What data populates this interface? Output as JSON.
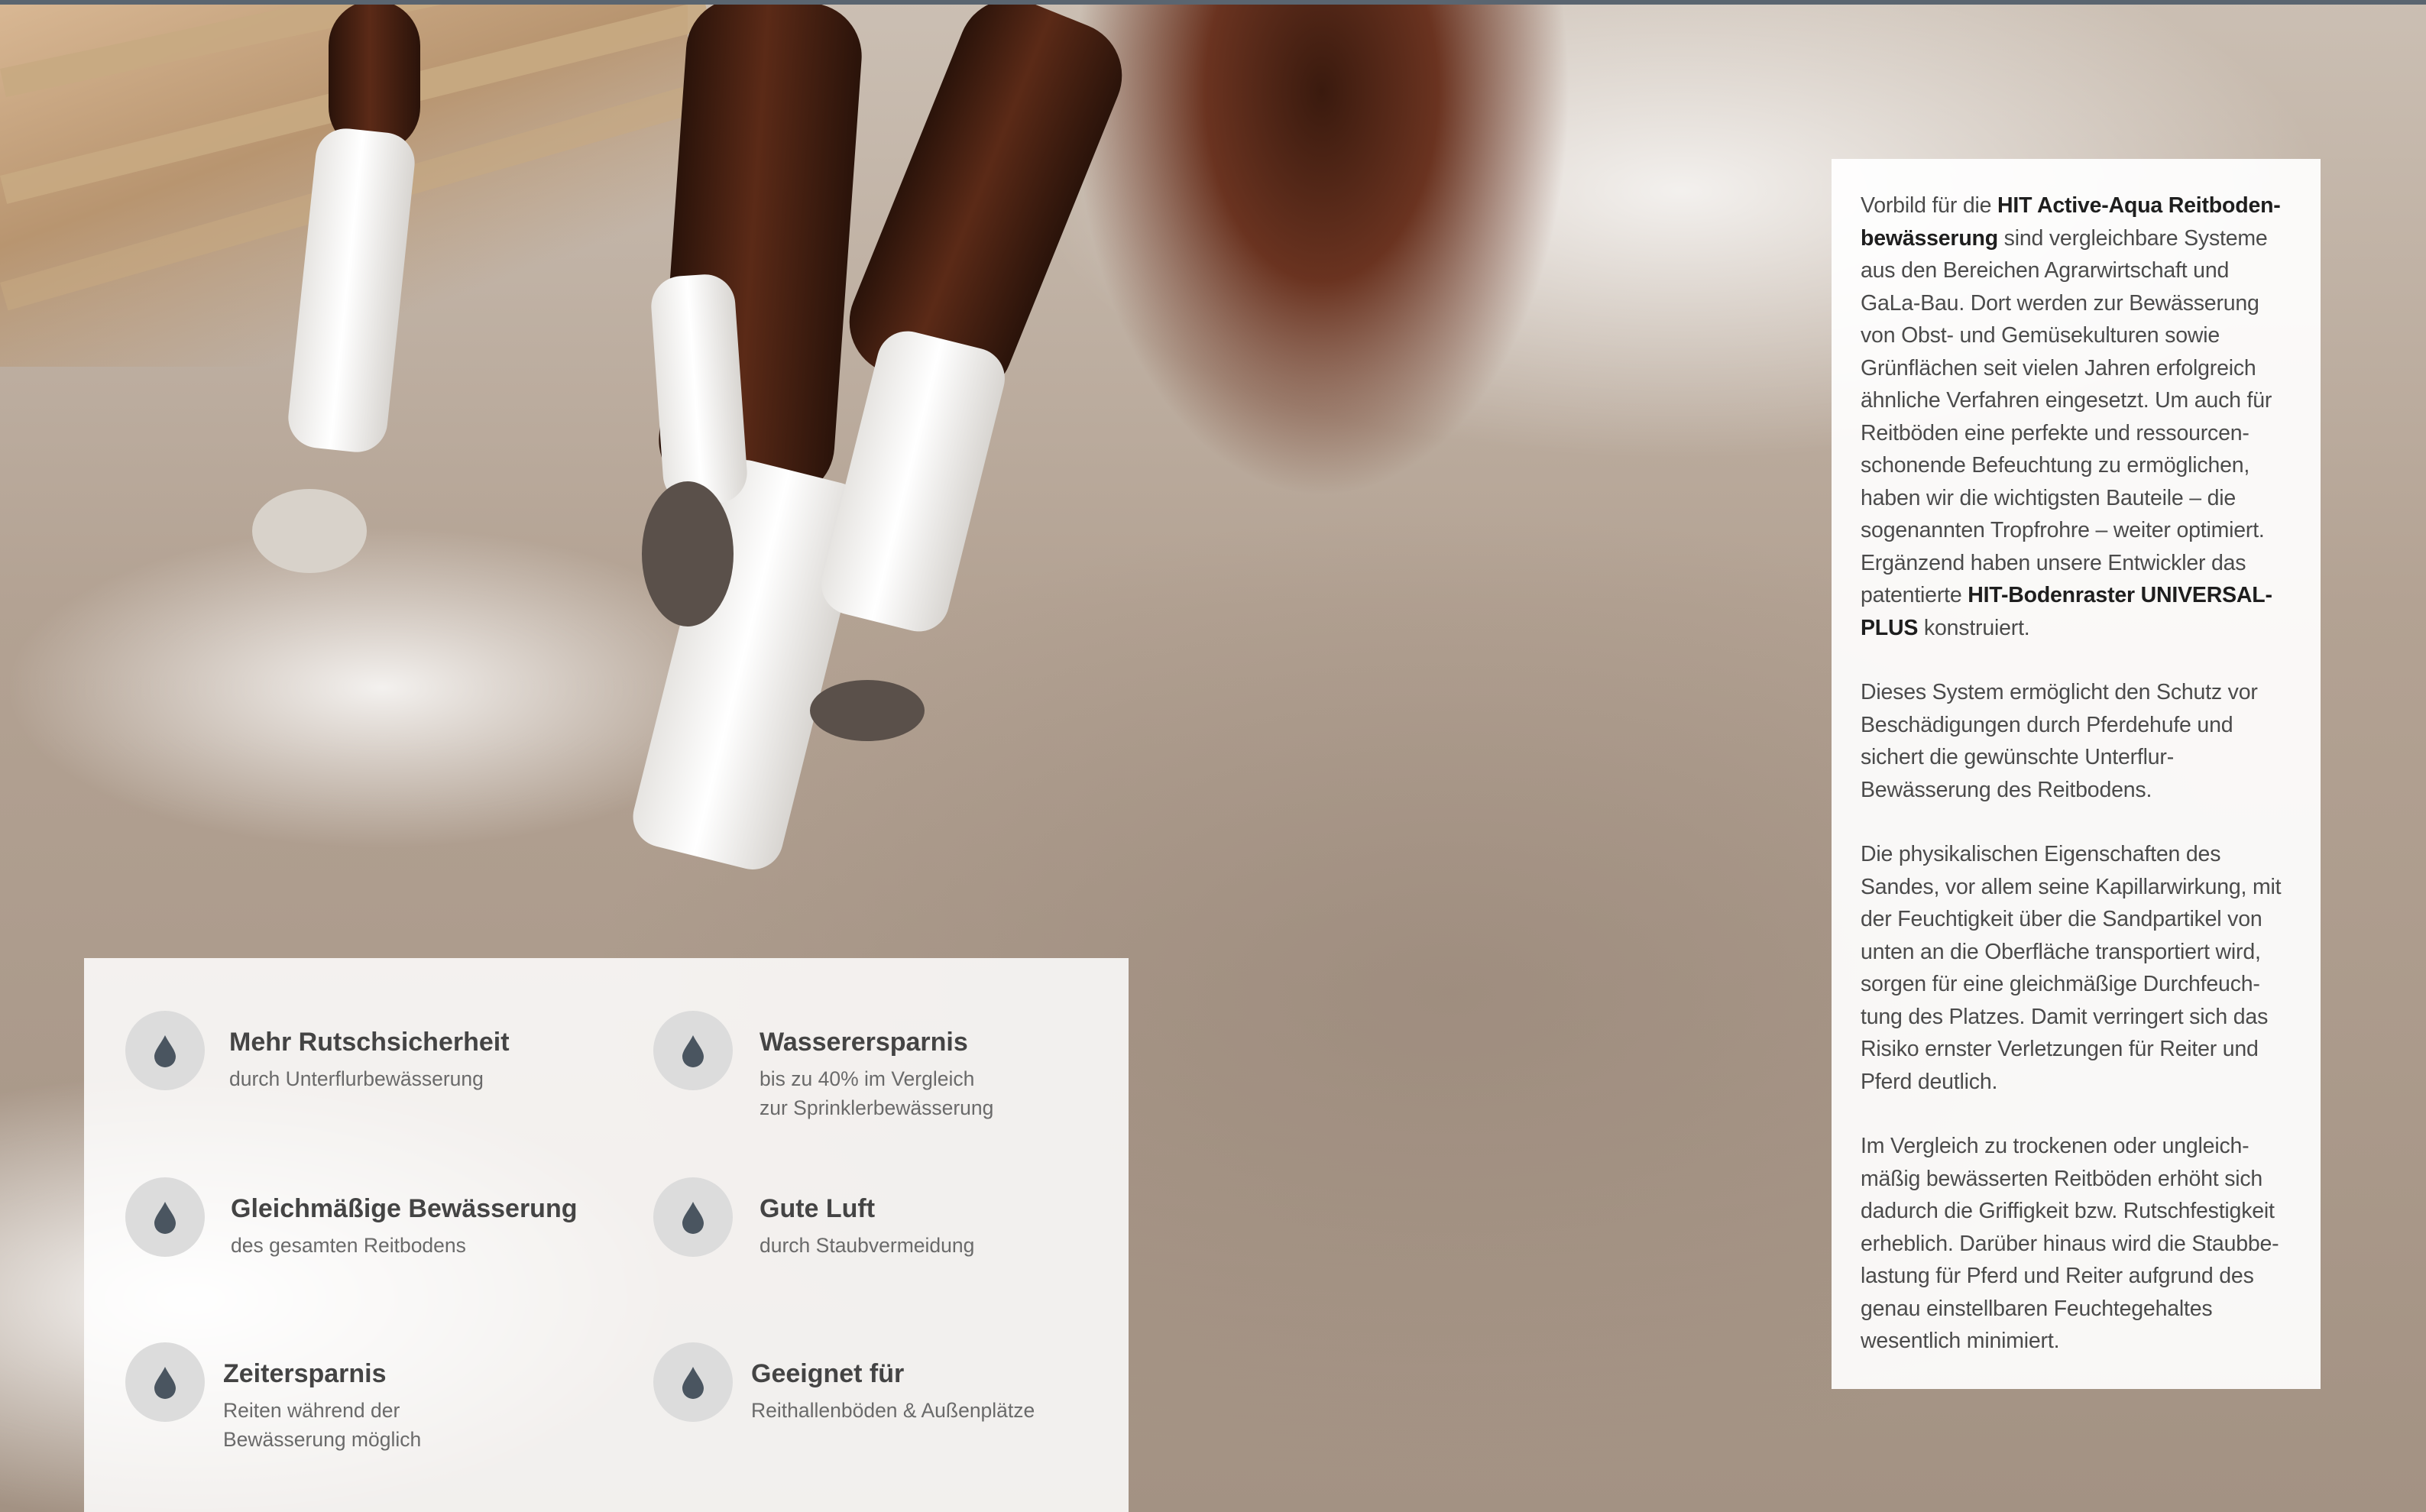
{
  "colors": {
    "panel_bg": "#ffffff",
    "icon_circle": "#dcdcdc",
    "icon_drop": "#4a5560",
    "text": "#4b4b4b",
    "bold_text": "#1e1e1e"
  },
  "background_image": {
    "description_icon": "horse-legs-in-riding-arena-photo"
  },
  "features": [
    {
      "icon": "water-drop-icon",
      "title": "Mehr Rutschsicherheit",
      "subtitle_lines": [
        "durch Unterflurbewässerung"
      ]
    },
    {
      "icon": "water-drop-icon",
      "title": "Wasserersparnis",
      "subtitle_lines": [
        "bis zu 40% im Vergleich",
        "zur Sprinklerbewässerung"
      ]
    },
    {
      "icon": "water-drop-icon",
      "title": "Gleichmäßige Bewässerung",
      "subtitle_lines": [
        "des gesamten Reitbodens"
      ]
    },
    {
      "icon": "water-drop-icon",
      "title": "Gute Luft",
      "subtitle_lines": [
        "durch Staubvermeidung"
      ]
    },
    {
      "icon": "water-drop-icon",
      "title": "Zeitersparnis",
      "subtitle_lines": [
        "Reiten während der",
        "Bewässerung möglich"
      ]
    },
    {
      "icon": "water-drop-icon",
      "title": "Geeignet für",
      "subtitle_lines": [
        "Reithallenböden & Außenplätze"
      ]
    }
  ],
  "article": {
    "p1": {
      "a": "Vorbild für die ",
      "b_bold": "HIT Active-Aqua Reitboden-bewässerung",
      "c": " sind vergleichbare Systeme aus den Bereichen Agrarwirtschaft und GaLa-Bau. Dort werden zur Bewässerung von Obst- und Gemüsekulturen sowie Grünflächen seit vielen Jahren erfolgreich ähnliche Verfahren eingesetzt. Um auch für Reitböden eine perfekte und ressourcen-schonende Befeuchtung zu ermöglichen, haben wir die wichtigsten Bauteile – die sogenannten Tropfrohre – weiter optimiert. Ergänzend haben unsere Entwickler das patentierte ",
      "d_bold": "HIT-Bodenraster UNIVERSAL-PLUS",
      "e": " konstruiert."
    },
    "p2": "Dieses System ermöglicht den Schutz vor Beschädigungen durch Pferdehufe und sichert die gewünschte Unterflur-Bewässerung des Reitbodens.",
    "p3": "Die physikalischen Eigenschaften des Sandes, vor allem seine Kapillarwirkung, mit der Feuchtigkeit über die Sandpartikel von unten an die Oberfläche transportiert wird, sorgen für eine gleichmäßige Durchfeuch-tung des Platzes. Damit verringert sich das Risiko ernster Verletzungen für Reiter und Pferd deutlich.",
    "p4": "Im Vergleich zu trockenen oder ungleich-mäßig bewässerten Reitböden erhöht sich dadurch die Griffigkeit bzw. Rutschfestigkeit erheblich. Darüber hinaus wird die Staubbe-lastung für Pferd und Reiter aufgrund des genau einstellbaren Feuchtegehaltes wesentlich minimiert."
  }
}
